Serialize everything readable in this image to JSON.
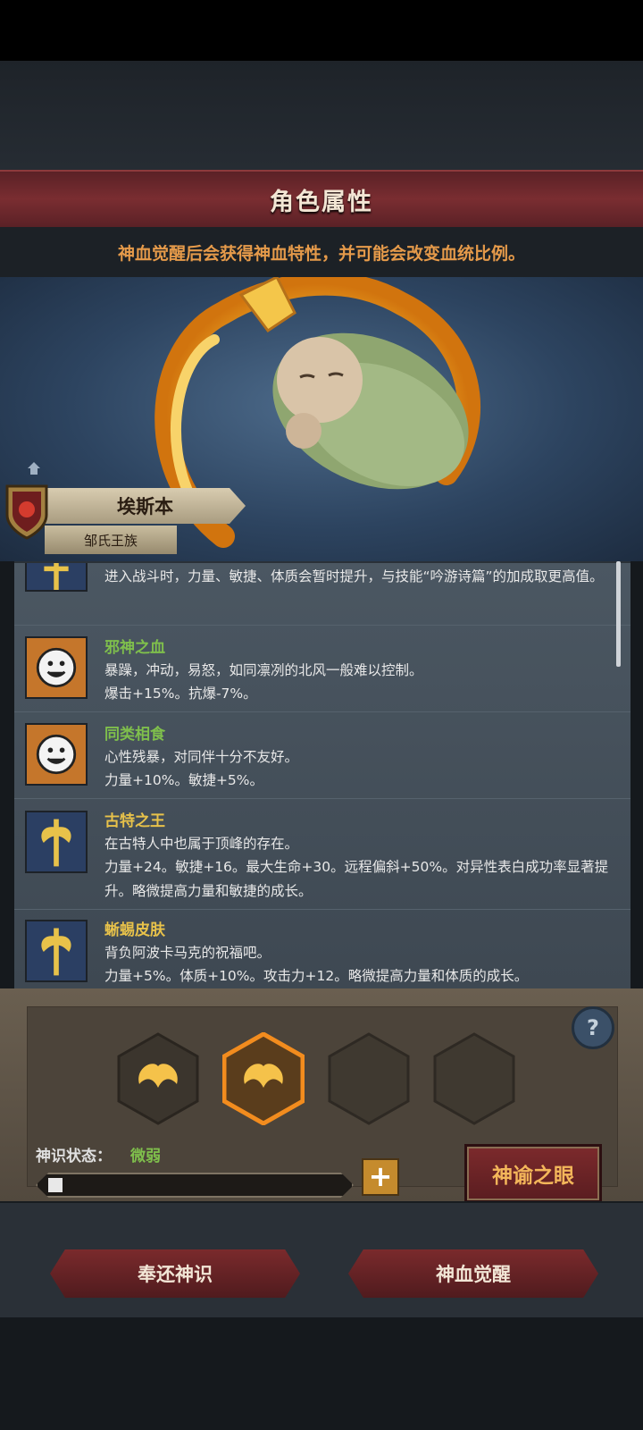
{
  "header": {
    "title": "角色属性",
    "subtitle": "神血觉醒后会获得神血特性，并可能会改变血统比例。"
  },
  "character": {
    "name": "埃斯本",
    "clan": "邹氏王族"
  },
  "traits": [
    {
      "name": "",
      "desc": "",
      "effect": "进入战斗时，力量、敏捷、体质会暂时提升，与技能“吟游诗篇”的加成取更高值。",
      "icon": "axe-icon",
      "name_color": "#e8c24a"
    },
    {
      "name": "邪神之血",
      "desc": "暴躁，冲动，易怒，如同凛冽的北风一般难以控制。",
      "effect": "爆击+15%。抗爆-7%。",
      "icon": "smiley-icon",
      "name_color": "#7fbf4c"
    },
    {
      "name": "同类相食",
      "desc": "心性残暴，对同伴十分不友好。",
      "effect": "力量+10%。敏捷+5%。",
      "icon": "smiley-icon",
      "name_color": "#7fbf4c"
    },
    {
      "name": "古特之王",
      "desc": "在古特人中也属于顶峰的存在。",
      "effect": "力量+24。敏捷+16。最大生命+30。远程偏斜+50%。对异性表白成功率显著提升。略微提高力量和敏捷的成长。",
      "icon": "axe-icon",
      "name_color": "#e8c24a"
    },
    {
      "name": "蜥蜴皮肤",
      "desc": "背负阿波卡马克的祝福吧。",
      "effect": "力量+5%。体质+10%。攻击力+12。略微提高力量和体质的成长。",
      "icon": "axe-icon",
      "name_color": "#e8c24a"
    }
  ],
  "divine": {
    "state_label": "神识状态：",
    "state_value": "微弱",
    "progress": 0.04,
    "slots": [
      "filled",
      "filled-selected",
      "empty",
      "empty"
    ],
    "help": "?",
    "plus": "+",
    "oracle_button": "神谕之眼"
  },
  "actions": {
    "return_button": "奉还神识",
    "awaken_button": "神血觉醒"
  }
}
